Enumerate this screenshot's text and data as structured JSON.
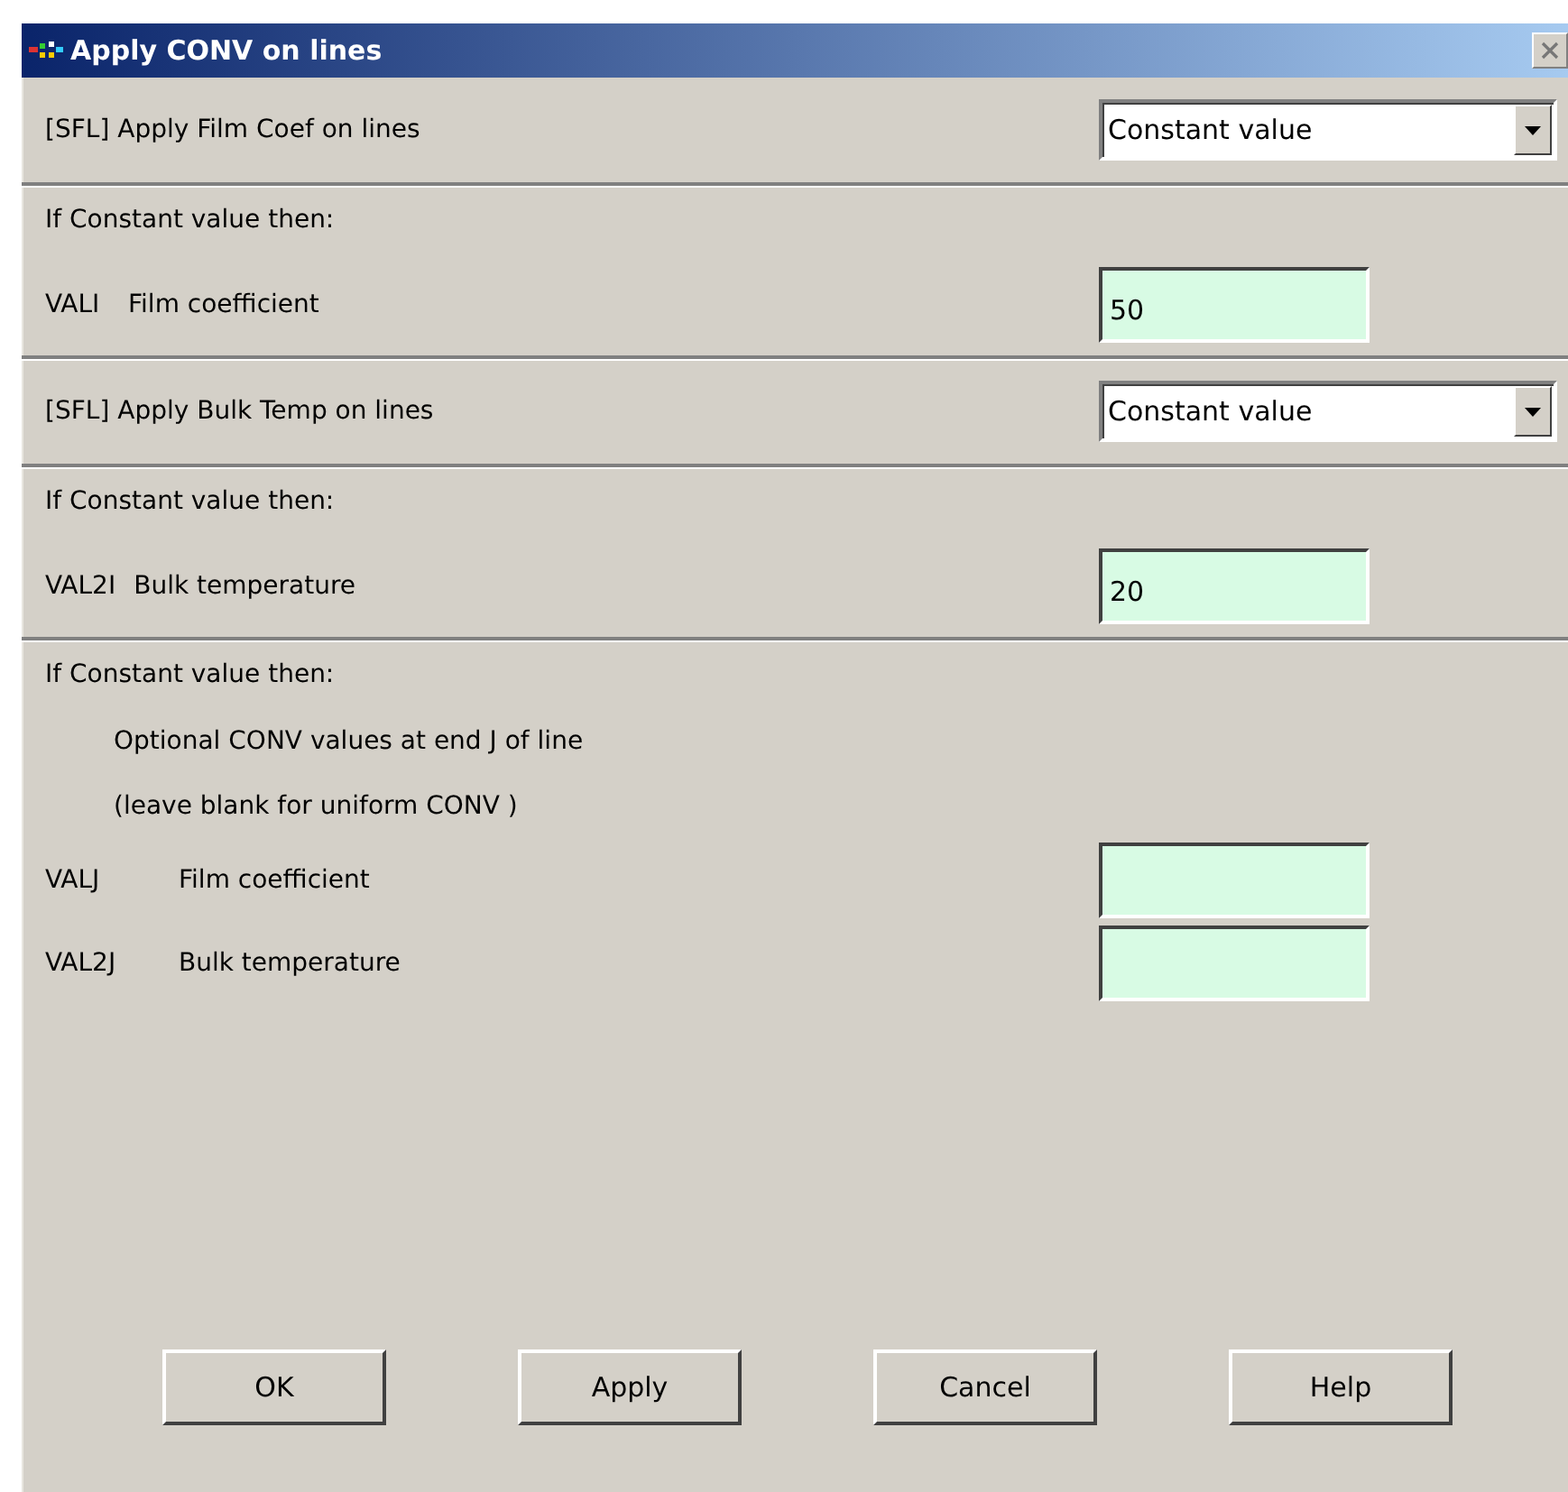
{
  "window": {
    "title": "Apply CONV on lines"
  },
  "sections": [
    {
      "rows": [
        {
          "kind": "dropdown",
          "label": "[SFL] Apply Film Coef on lines",
          "value": "Constant value"
        }
      ]
    },
    {
      "rows": [
        {
          "kind": "text",
          "label": "If Constant value then:"
        },
        {
          "kind": "field",
          "code": "VALI",
          "label": "Film coefficient",
          "value": "50"
        }
      ]
    },
    {
      "rows": [
        {
          "kind": "dropdown",
          "label": "[SFL] Apply Bulk Temp on lines",
          "value": "Constant value"
        }
      ]
    },
    {
      "rows": [
        {
          "kind": "text",
          "label": "If Constant value then:"
        },
        {
          "kind": "field",
          "code": "VAL2I",
          "label": "Bulk temperature",
          "value": "20"
        }
      ]
    },
    {
      "rows": [
        {
          "kind": "text",
          "label": "If Constant value then:"
        },
        {
          "kind": "note",
          "label": "Optional CONV values at end J of line"
        },
        {
          "kind": "note",
          "label": "(leave blank for uniform CONV )"
        },
        {
          "kind": "field",
          "code": "VALJ",
          "label": "Film coefficient"
        },
        {
          "kind": "field",
          "code": "VAL2J",
          "label": "Bulk temperature"
        }
      ]
    }
  ],
  "buttons": [
    "OK",
    "Apply",
    "Cancel",
    "Help"
  ]
}
